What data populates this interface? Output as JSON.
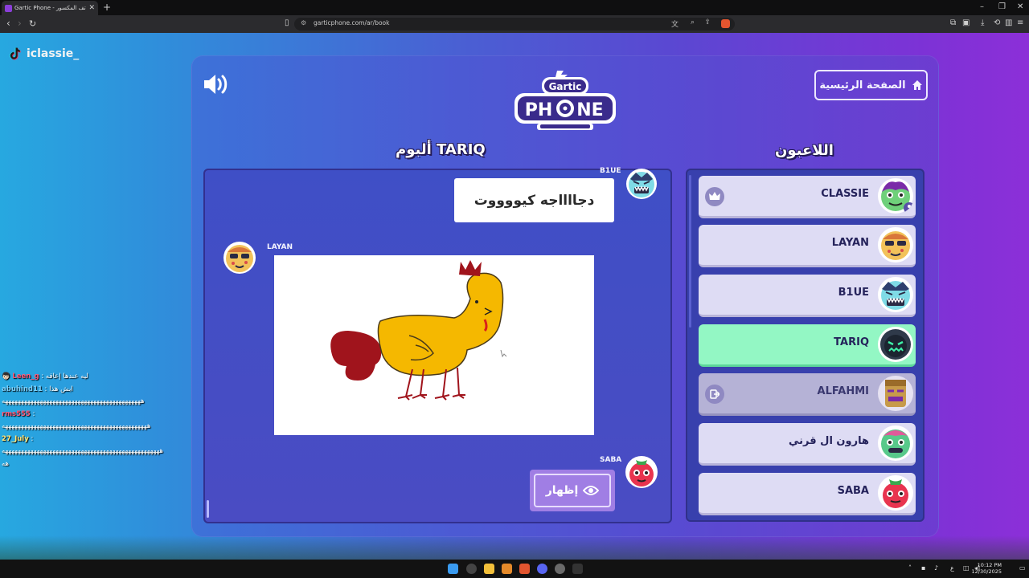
{
  "browser": {
    "tab_title": "Gartic Phone - لعبة الهاتف المكسور",
    "tab_close": "✕",
    "new_tab": "+",
    "url": "garticphone.com/ar/book",
    "window_controls": [
      "–",
      "❐",
      "✕"
    ]
  },
  "streamer": {
    "name": "iclassie_",
    "icon": "tiktok-icon"
  },
  "game": {
    "home_button_label": "الصفحة الرئيسية",
    "album_title": "ألبوم TARIQ",
    "players_title": "اللاعبون",
    "caption": "دجااااجه كيووووت",
    "show_button_label": "إظهار",
    "sound_icon": "speaker-icon",
    "authors": {
      "caption_author": "B1UE",
      "drawing_author": "LAYAN",
      "next_author": "SABA"
    },
    "players": [
      {
        "name": "CLASSIE",
        "badge": "crown-icon",
        "state": "normal"
      },
      {
        "name": "LAYAN",
        "state": "normal"
      },
      {
        "name": "B1UE",
        "state": "normal"
      },
      {
        "name": "TARIQ",
        "state": "active"
      },
      {
        "name": "ALFAHMI",
        "badge": "exit-icon",
        "state": "disabled"
      },
      {
        "name": "هارون ال قرني",
        "state": "normal"
      },
      {
        "name": "SABA",
        "state": "normal"
      }
    ]
  },
  "chat": [
    {
      "user": "Leen_g",
      "text": ": ليه عندها إعاقه"
    },
    {
      "user": "abuhind11",
      "text": ": ابش هذا"
    },
    {
      "user": "",
      "text": "ههههههههههههههههههههههههههههههههههههههههههههه"
    },
    {
      "user": "rms555",
      "text": ":"
    },
    {
      "user": "",
      "text": "ههههههههههههههههههههههههههههههههههههههههههههههه"
    },
    {
      "user": "27_July",
      "text": ":"
    },
    {
      "user": "",
      "text": "ههههههههههههههههههههههههههههههههههههههههههههههههههه"
    },
    {
      "user": "",
      "text": "هه"
    }
  ],
  "taskbar": {
    "time": "10:12 PM",
    "date": "12/30/2025",
    "lang": "ع"
  },
  "colors": {
    "active_player": "#93f7c4",
    "panel": "#3840ad",
    "accent": "#a07ee4"
  }
}
